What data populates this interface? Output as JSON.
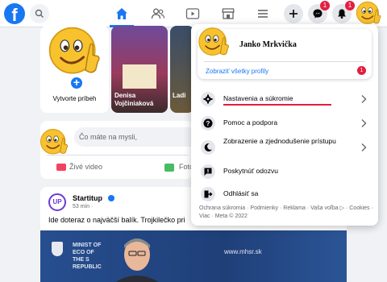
{
  "topbar": {
    "logo_letter": "f",
    "messenger_badge": "1",
    "notifications_badge": "1"
  },
  "stories": {
    "create_label": "Vytvorte príbeh",
    "story1_name": "Denisa Vojčiniaková",
    "story2_name": "Ladi"
  },
  "composer": {
    "placeholder": "Čo máte na mysli,",
    "live_label": "Živé video",
    "photo_label": "Foto"
  },
  "post": {
    "avatar_text": "UP",
    "author": "Startitup",
    "time": "53 min ·",
    "text": "Ide doteraz o najväčší balík. Trojkilečko pri",
    "image_text": "MINIST OF ECO OF THE S REPUBLIC",
    "image_web": "www.mhsr.sk"
  },
  "menu": {
    "profile_name": "Janko Mrkvička",
    "profiles_link": "Zobraziť všetky profily",
    "profiles_badge": "1",
    "items": [
      {
        "label": "Nastavenia a súkromie"
      },
      {
        "label": "Pomoc a podpora"
      },
      {
        "label": "Zobrazenie a zjednodušenie prístupu"
      },
      {
        "label": "Poskytnúť odozvu"
      },
      {
        "label": "Odhlásiť sa"
      }
    ],
    "footer": "Ochrana súkromia · Podmienky · Reklama · Vaša voľba ▷ · Cookies · Viac · Meta © 2022"
  },
  "colors": {
    "brand": "#1877f2",
    "badge": "#e41e3f",
    "emoji": "#f7c22e"
  }
}
